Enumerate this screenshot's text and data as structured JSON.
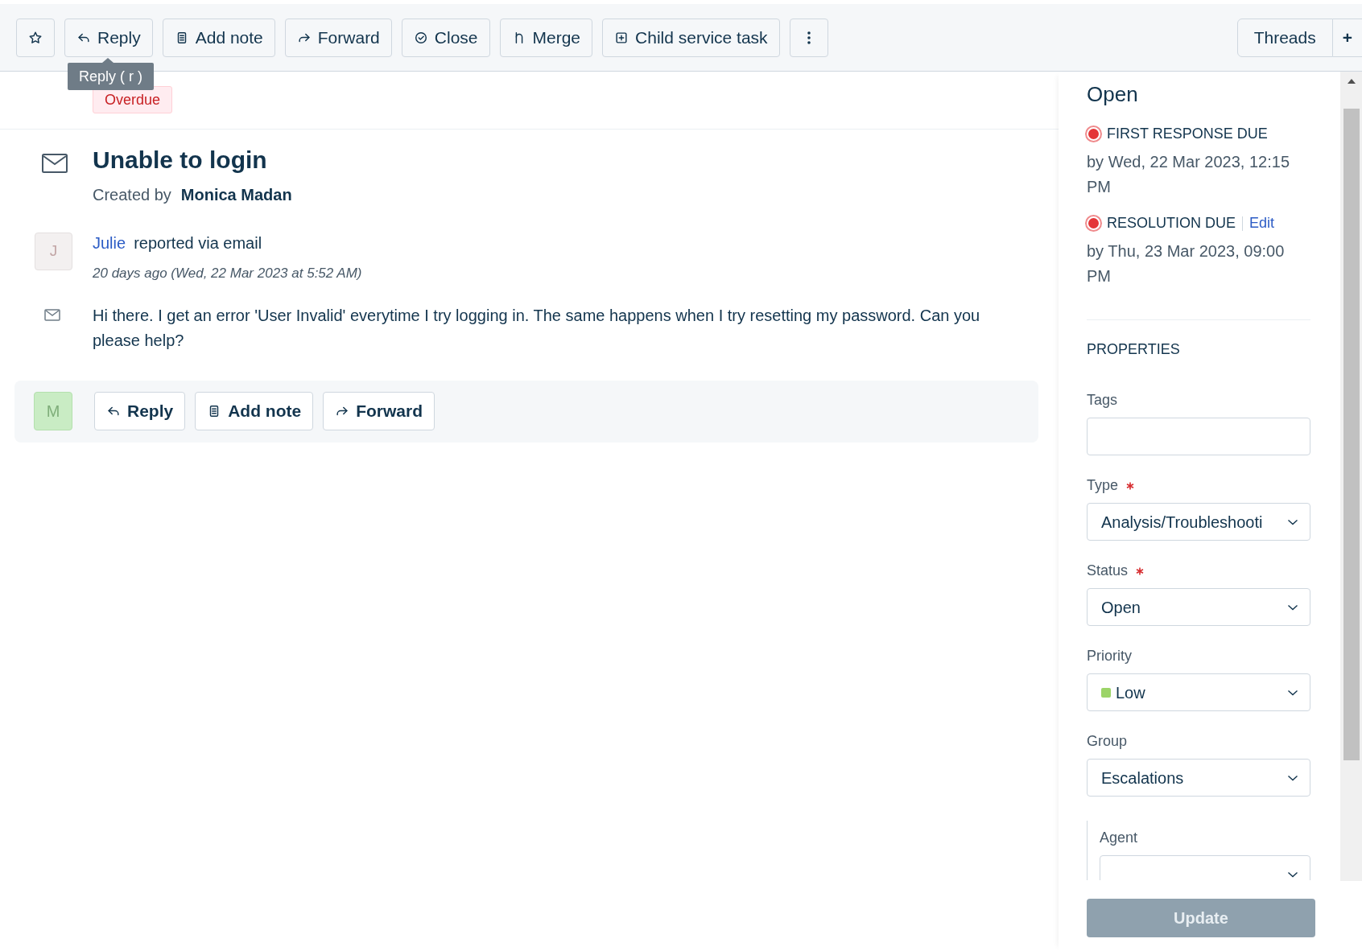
{
  "toolbar": {
    "buttons": [
      "Reply",
      "Add note",
      "Forward",
      "Close",
      "Merge",
      "Child service task"
    ],
    "tooltip": "Reply ( r )",
    "right_tabs": [
      "Threads",
      "+"
    ]
  },
  "ticket": {
    "badge": "Overdue",
    "title": "Unable to login",
    "created_by_label": "Created by",
    "creator": "Monica Madan"
  },
  "conversation": {
    "avatar": "J",
    "sender": "Julie",
    "via": "reported via email",
    "time": "20 days ago (Wed, 22 Mar 2023 at 5:52 AM)",
    "body": "Hi there. I get an error 'User Invalid' everytime I try logging in. The same happens when I try resetting my password. Can you please help?"
  },
  "reply_bar": {
    "avatar": "M",
    "buttons": [
      "Reply",
      "Add note",
      "Forward"
    ]
  },
  "sidebar": {
    "status": "Open",
    "sla": [
      {
        "label": "FIRST RESPONSE DUE",
        "due": "by Wed, 22 Mar 2023, 12:15 PM",
        "overdue": true
      },
      {
        "label": "RESOLUTION DUE",
        "edit": "Edit",
        "due": "by Thu, 23 Mar 2023, 09:00 PM",
        "overdue": true
      }
    ],
    "properties_heading": "PROPERTIES",
    "fields": [
      {
        "label": "Tags",
        "kind": "text",
        "required": false
      },
      {
        "label": "Type",
        "kind": "select",
        "required": true,
        "value": "Analysis/Troubleshooti"
      },
      {
        "label": "Status",
        "kind": "select",
        "required": true,
        "value": "Open"
      },
      {
        "label": "Priority",
        "kind": "select",
        "required": false,
        "value": "Low",
        "color": "#9cd468"
      },
      {
        "label": "Group",
        "kind": "select",
        "required": false,
        "value": "Escalations"
      },
      {
        "label": "Agent",
        "kind": "nested_select",
        "required": false
      }
    ],
    "update": {
      "label": "Update",
      "disabled": true
    }
  }
}
